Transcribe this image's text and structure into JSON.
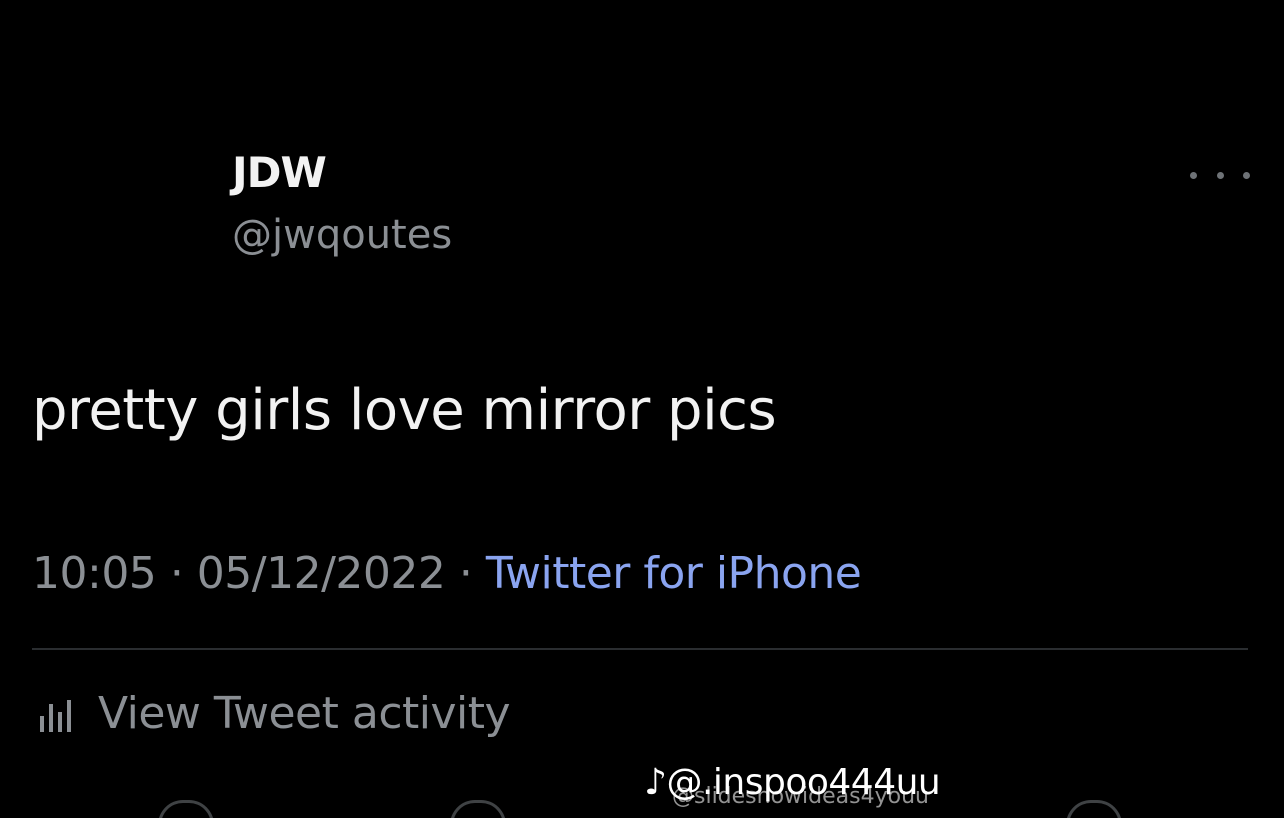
{
  "tweet": {
    "display_name": "JDW",
    "handle": "@jwqoutes",
    "text": "pretty girls love mirror pics",
    "time": "10:05",
    "separator": "·",
    "date": "05/12/2022",
    "source": "Twitter for iPhone",
    "activity_label": "View Tweet activity",
    "more_icon": "more-horizontal-icon",
    "activity_icon": "bar-chart-icon"
  },
  "watermark": {
    "main": "@.inspoo444uu",
    "sub": "@slideshowideas4youu"
  },
  "colors": {
    "background": "#000000",
    "primary_text": "#f2f2f2",
    "secondary_text": "#8b8f94",
    "link": "#8aa4f0",
    "divider": "#2a2d30"
  }
}
